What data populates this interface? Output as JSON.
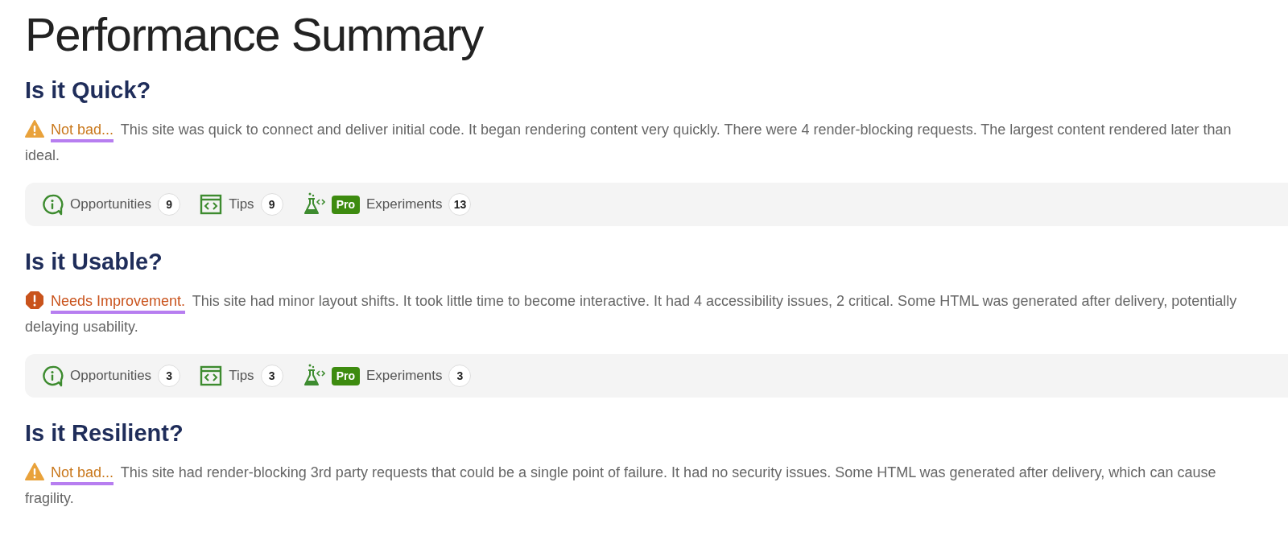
{
  "title": "Performance Summary",
  "sections": [
    {
      "heading": "Is it Quick?",
      "status": {
        "kind": "warning",
        "label": "Not bad..."
      },
      "text": "This site was quick to connect and deliver initial code. It began rendering content very quickly. There were 4 render-blocking requests. The largest content rendered later than ideal.",
      "toolbar": [
        {
          "kind": "opportunities",
          "label": "Opportunities",
          "count": "9"
        },
        {
          "kind": "tips",
          "label": "Tips",
          "count": "9"
        },
        {
          "kind": "experiments",
          "badge": "Pro",
          "label": "Experiments",
          "count": "13"
        }
      ]
    },
    {
      "heading": "Is it Usable?",
      "status": {
        "kind": "critical",
        "label": "Needs Improvement."
      },
      "text": "This site had minor layout shifts. It took little time to become interactive. It had 4 accessibility issues, 2 critical. Some HTML was generated after delivery, potentially delaying usability.",
      "toolbar": [
        {
          "kind": "opportunities",
          "label": "Opportunities",
          "count": "3"
        },
        {
          "kind": "tips",
          "label": "Tips",
          "count": "3"
        },
        {
          "kind": "experiments",
          "badge": "Pro",
          "label": "Experiments",
          "count": "3"
        }
      ]
    },
    {
      "heading": "Is it Resilient?",
      "status": {
        "kind": "warning",
        "label": "Not bad..."
      },
      "text": "This site had render-blocking 3rd party requests that could be a single point of failure. It had no security issues. Some HTML was generated after delivery, which can cause fragility."
    }
  ]
}
